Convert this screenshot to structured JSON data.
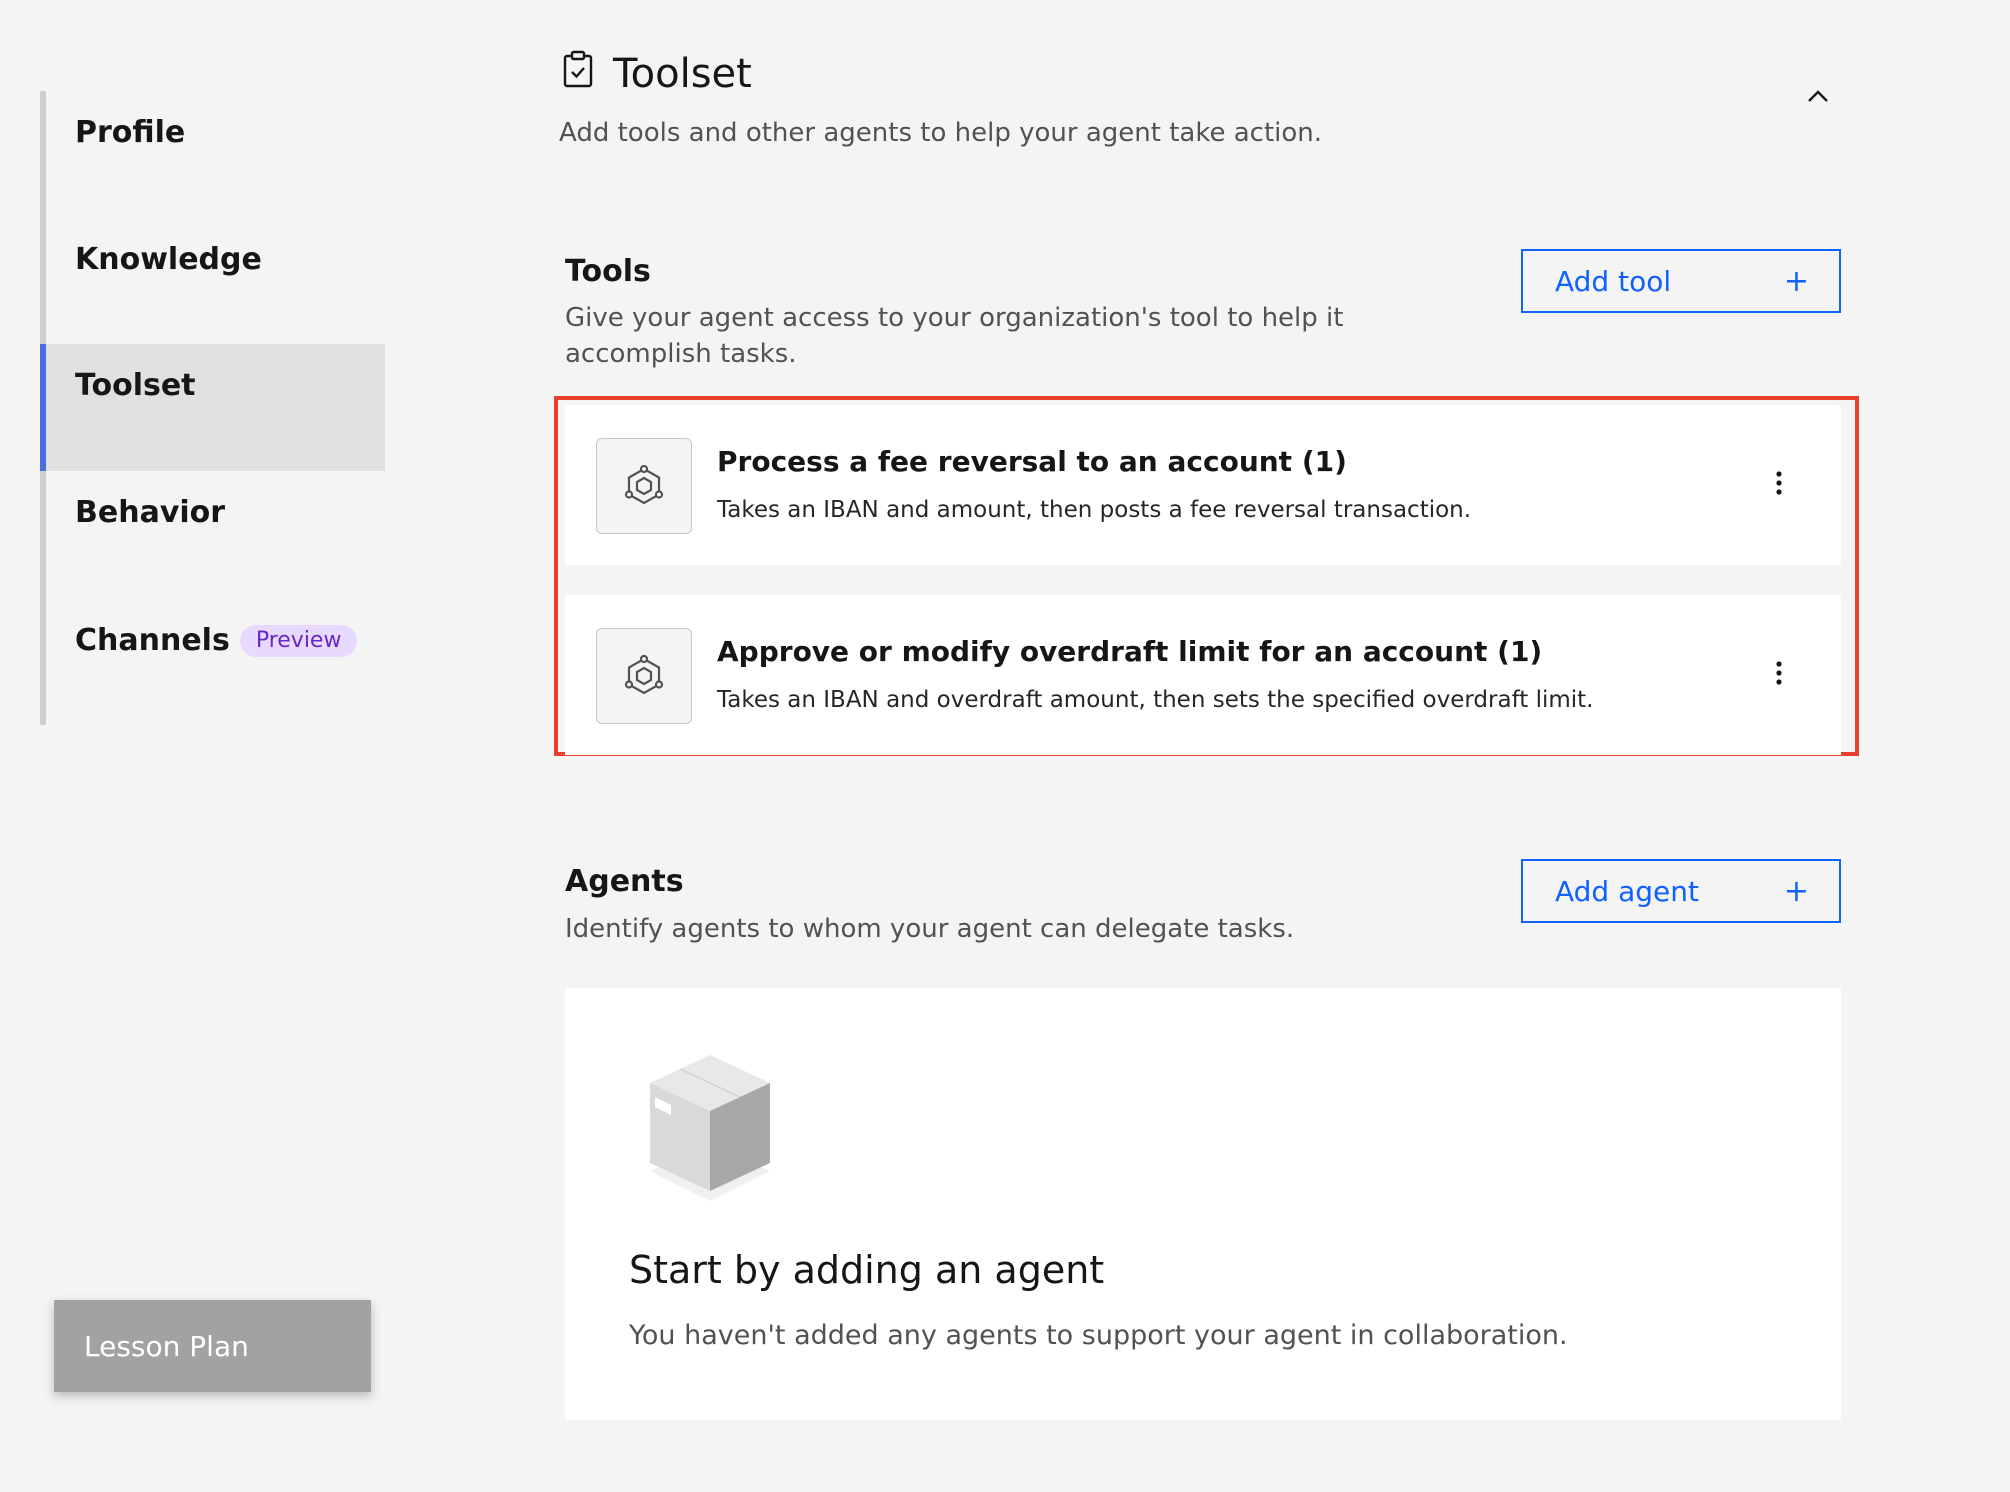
{
  "sidebar": {
    "items": [
      {
        "label": "Profile"
      },
      {
        "label": "Knowledge"
      },
      {
        "label": "Toolset"
      },
      {
        "label": "Behavior"
      },
      {
        "label": "Channels",
        "tag": "Preview"
      }
    ],
    "active": "Toolset",
    "lesson_plan_label": "Lesson Plan"
  },
  "section": {
    "title": "Toolset",
    "subtitle": "Add tools and other agents to help your agent take action."
  },
  "tools": {
    "title": "Tools",
    "description": "Give your agent access to your organization's tool to help it accomplish tasks.",
    "add_label": "Add tool",
    "items": [
      {
        "name": "Process a fee reversal to an account (1)",
        "description": "Takes an IBAN and amount, then posts a fee reversal transaction."
      },
      {
        "name": "Approve or modify overdraft limit for an account (1)",
        "description": "Takes an IBAN and overdraft amount, then sets the specified overdraft limit."
      }
    ]
  },
  "agents": {
    "title": "Agents",
    "description": "Identify agents to whom your agent can delegate tasks.",
    "add_label": "Add agent",
    "empty_title": "Start by adding an agent",
    "empty_description": "You haven't added any agents to support your agent in collaboration."
  },
  "colors": {
    "accent": "#0f62fe",
    "active_indicator": "#4a6ee0",
    "highlight": "#e8402c",
    "preview_bg": "#e8dafe",
    "preview_text": "#6929c4"
  },
  "icons": {
    "section": "clipboard-check-icon",
    "collapse": "chevron-up-icon",
    "tool": "hexagon-network-icon",
    "overflow": "overflow-menu-vertical-icon",
    "empty": "box-illustration"
  }
}
